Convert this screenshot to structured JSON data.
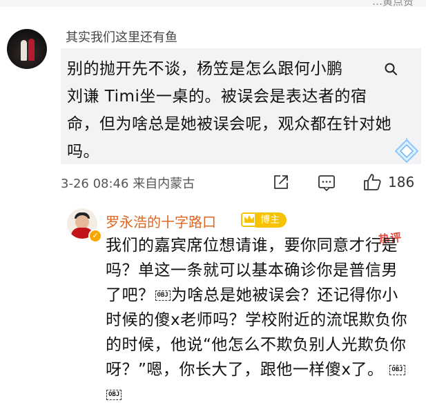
{
  "top_partial": "…黄点赞",
  "comment1": {
    "username": "其实我们这里还有鱼",
    "text": "别的抛开先不谈，杨笠是怎么跟何小鹏",
    "text2": "刘谦 Timi坐一桌的。被误会是表达者的宿命，但为啥总是她被误会呢，观众都在针对她吗。",
    "time": "3-26 08:46",
    "location": "来自内蒙古",
    "likes": "186"
  },
  "reply": {
    "username": "罗永浩的十字路口",
    "role_badge": "博主",
    "hot_label": "热评",
    "segments": [
      "我们的嘉宾席位想请谁，要你同意才行是吗？单这一条就可以基本确诊你是普信男了吧？",
      "为啥总是她被误会？还记得你小时候的傻x老师吗？学校附近的流氓欺负你的时候，他说“他怎么不欺负别人光欺负你呀？”嗯，你长大了，跟他一样傻x了。"
    ],
    "obj_label": "OBJ"
  },
  "colors": {
    "username_orange": "#e0661f",
    "badge_yellow": "#f7c200",
    "hot_red": "#e8473c"
  },
  "icons": [
    "search-icon",
    "diamond-icon",
    "share-icon",
    "comment-icon",
    "like-icon",
    "crown-icon",
    "verified-icon"
  ]
}
